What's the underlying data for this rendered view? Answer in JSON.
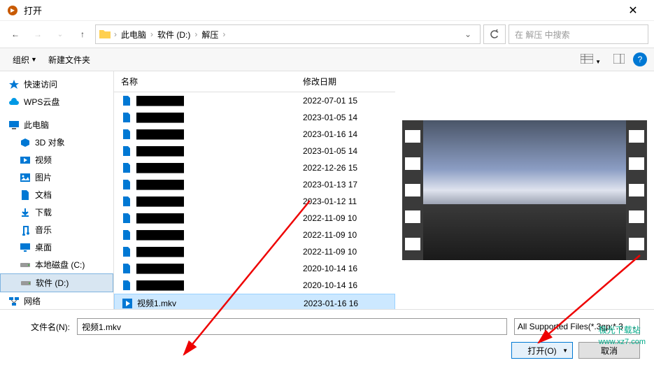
{
  "title": "打开",
  "breadcrumb": [
    "此电脑",
    "软件 (D:)",
    "解压"
  ],
  "search_placeholder": "在 解压 中搜索",
  "toolbar": {
    "organize": "组织",
    "new_folder": "新建文件夹"
  },
  "sidebar": [
    {
      "icon": "star",
      "label": "快速访问",
      "indent": 0
    },
    {
      "icon": "cloud",
      "label": "WPS云盘",
      "indent": 0
    },
    {
      "icon": "pc",
      "label": "此电脑",
      "indent": 0
    },
    {
      "icon": "3d",
      "label": "3D 对象",
      "indent": 1
    },
    {
      "icon": "video",
      "label": "视频",
      "indent": 1
    },
    {
      "icon": "image",
      "label": "图片",
      "indent": 1
    },
    {
      "icon": "doc",
      "label": "文档",
      "indent": 1
    },
    {
      "icon": "download",
      "label": "下载",
      "indent": 1
    },
    {
      "icon": "music",
      "label": "音乐",
      "indent": 1
    },
    {
      "icon": "desktop",
      "label": "桌面",
      "indent": 1
    },
    {
      "icon": "disk",
      "label": "本地磁盘 (C:)",
      "indent": 1
    },
    {
      "icon": "disk",
      "label": "软件 (D:)",
      "indent": 1,
      "selected": true
    },
    {
      "icon": "network",
      "label": "网络",
      "indent": 0
    }
  ],
  "columns": {
    "name": "名称",
    "date": "修改日期"
  },
  "files": [
    {
      "name": "",
      "date": "2022-07-01 15",
      "blurred": true
    },
    {
      "name": "",
      "date": "2023-01-05 14",
      "blurred": true
    },
    {
      "name": "",
      "date": "2023-01-16 14",
      "blurred": true
    },
    {
      "name": "",
      "date": "2023-01-05 14",
      "blurred": true
    },
    {
      "name": "",
      "date": "2022-12-26 15",
      "blurred": true
    },
    {
      "name": "",
      "date": "2023-01-13 17",
      "blurred": true
    },
    {
      "name": "",
      "date": "2023-01-12 11",
      "blurred": true
    },
    {
      "name": "",
      "date": "2022-11-09 10",
      "blurred": true
    },
    {
      "name": "",
      "date": "2022-11-09 10",
      "blurred": true
    },
    {
      "name": "",
      "date": "2022-11-09 10",
      "blurred": true
    },
    {
      "name": "",
      "date": "2020-10-14 16",
      "blurred": true
    },
    {
      "name": "",
      "date": "2020-10-14 16",
      "blurred": true
    },
    {
      "name": "视频1.mkv",
      "date": "2023-01-16 16",
      "blurred": false,
      "selected": true,
      "icon": "video-file"
    }
  ],
  "filename_label": "文件名(N):",
  "filename_value": "视频1.mkv",
  "filter": "All Supported Files(*.3gp;*.3",
  "buttons": {
    "open": "打开(O)",
    "cancel": "取消"
  },
  "watermark": "极光下载站",
  "watermark_url": "www.xz7.com"
}
